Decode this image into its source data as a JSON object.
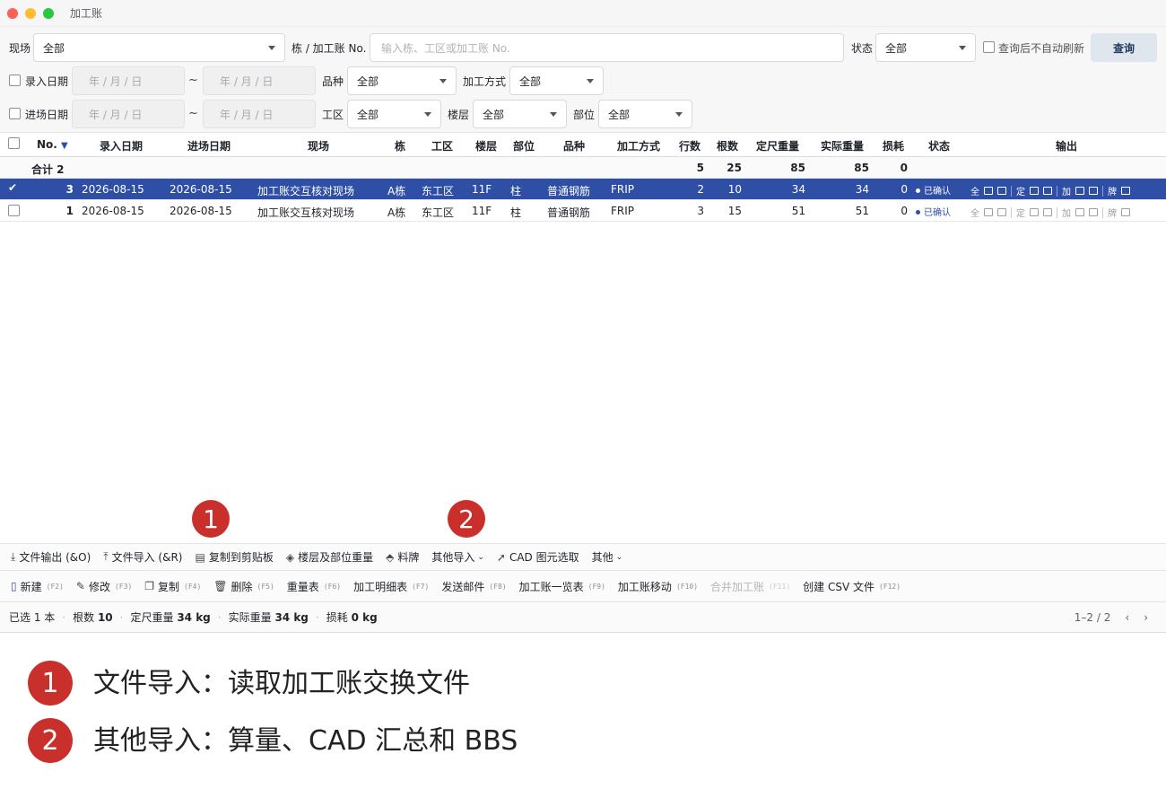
{
  "window": {
    "title": "加工账"
  },
  "filters": {
    "site_label": "现场",
    "site_value": "全部",
    "building_label": "栋 / 加工账 No.",
    "building_placeholder": "输入栋、工区或加工账 No.",
    "status_label": "状态",
    "status_value": "全部",
    "noauto_label": "查询后不自动刷新",
    "query_button": "查询",
    "entry_date_label": "录入日期",
    "date_placeholder": "年 / 月 / 日",
    "tilde": "~",
    "variety_label": "品种",
    "variety_value": "全部",
    "method_label": "加工方式",
    "method_value": "全部",
    "arrival_date_label": "进场日期",
    "zone_label": "工区",
    "zone_value": "全部",
    "floor_label": "楼层",
    "floor_value": "全部",
    "part_label": "部位",
    "part_value": "全部"
  },
  "grid": {
    "headers": {
      "no": "No.",
      "sort_icon": "▼",
      "entry_date": "录入日期",
      "arrival_date": "进场日期",
      "site": "现场",
      "building": "栋",
      "zone": "工区",
      "floor": "楼层",
      "part": "部位",
      "variety": "品种",
      "method": "加工方式",
      "rows": "行数",
      "count": "根数",
      "std_weight": "定尺重量",
      "actual_weight": "实际重量",
      "loss": "损耗",
      "status": "状态",
      "output": "输出"
    },
    "summary": {
      "label": "合计 2",
      "rows": "5",
      "count": "25",
      "std_weight": "85",
      "actual_weight": "85",
      "loss": "0"
    },
    "rows": [
      {
        "no": "3",
        "entry_date": "2026-08-15",
        "arrival_date": "2026-08-15",
        "site": "加工账交互核对现场",
        "building": "A栋",
        "zone": "东工区",
        "floor": "11F",
        "part": "柱",
        "variety": "普通钢筋",
        "method": "FRIP",
        "rows": "2",
        "count": "10",
        "std_weight": "34",
        "actual_weight": "34",
        "loss": "0",
        "status": "已确认",
        "selected": true
      },
      {
        "no": "1",
        "entry_date": "2026-08-15",
        "arrival_date": "2026-08-15",
        "site": "加工账交互核对现场",
        "building": "A栋",
        "zone": "东工区",
        "floor": "11F",
        "part": "柱",
        "variety": "普通钢筋",
        "method": "FRIP",
        "rows": "3",
        "count": "15",
        "std_weight": "51",
        "actual_weight": "51",
        "loss": "0",
        "status": "已确认",
        "selected": false
      }
    ],
    "output_labels": {
      "all": "全",
      "fixed": "定",
      "proc": "加",
      "tag": "牌"
    }
  },
  "toolbar1": {
    "file_export": "文件输出 (&O)",
    "file_import": "文件导入 (&R)",
    "copy_clipboard": "复制到剪贴板",
    "floor_weight": "楼层及部位重量",
    "tag": "料牌",
    "other_import": "其他导入",
    "cad_select": "CAD 图元选取",
    "other": "其他"
  },
  "toolbar2": {
    "new": "新建",
    "new_key": "(F2)",
    "edit": "修改",
    "edit_key": "(F3)",
    "copy": "复制",
    "copy_key": "(F4)",
    "delete": "删除",
    "delete_key": "(F5)",
    "weight_table": "重量表",
    "weight_table_key": "(F6)",
    "detail_table": "加工明细表",
    "detail_table_key": "(F7)",
    "send_mail": "发送邮件",
    "send_mail_key": "(F8)",
    "list": "加工账一览表",
    "list_key": "(F9)",
    "move": "加工账移动",
    "move_key": "(F10)",
    "merge": "合并加工账",
    "merge_key": "(F11)",
    "csv": "创建 CSV 文件",
    "csv_key": "(F12)"
  },
  "statusbar": {
    "selected": "已选 1 本",
    "count_label": "根数",
    "count": "10",
    "std_label": "定尺重量",
    "std": "34 kg",
    "actual_label": "实际重量",
    "actual": "34 kg",
    "loss_label": "损耗",
    "loss": "0 kg",
    "pager": "1–2 / 2"
  },
  "annotations": {
    "badge1": "1",
    "badge2": "2",
    "legend1": "文件导入：读取加工账交换文件",
    "legend2": "其他导入：算量、CAD 汇总和 BBS"
  },
  "colors": {
    "accent": "#2f4fa6",
    "badge": "#c9302c"
  }
}
